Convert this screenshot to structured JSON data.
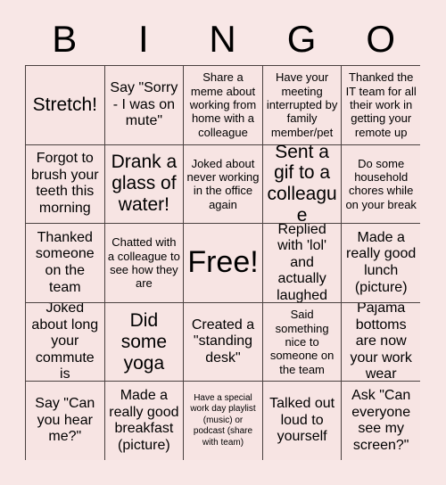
{
  "card": {
    "title": "BINGO",
    "background_color": "#f8e7e6",
    "cell_color": "#f7e4e3",
    "border_color": "#4a4140",
    "text_color": "#000000",
    "header_letters": [
      "B",
      "I",
      "N",
      "G",
      "O"
    ],
    "grid_size": "5x5",
    "free_space": "Free!",
    "rows": [
      [
        {
          "text": "Stretch!",
          "size": "lg"
        },
        {
          "text": "Say \"Sorry - I was on mute\"",
          "size": "md"
        },
        {
          "text": "Share a meme about working from home with a colleague",
          "size": "sm"
        },
        {
          "text": "Have your meeting interrupted by family member/pet",
          "size": "sm"
        },
        {
          "text": "Thanked the IT team for all their work in getting your remote up",
          "size": "sm"
        }
      ],
      [
        {
          "text": "Forgot to brush your teeth this morning",
          "size": "md"
        },
        {
          "text": "Drank a glass of water!",
          "size": "lg"
        },
        {
          "text": "Joked about never working in the office again",
          "size": "sm"
        },
        {
          "text": "Sent a gif to a colleague",
          "size": "lg"
        },
        {
          "text": "Do some household chores while on your break",
          "size": "sm"
        }
      ],
      [
        {
          "text": "Thanked someone on the team",
          "size": "md"
        },
        {
          "text": "Chatted with a colleague to see how they are",
          "size": "sm"
        },
        {
          "text": "Free!",
          "size": "xl"
        },
        {
          "text": "Replied with 'lol' and actually laughed",
          "size": "md"
        },
        {
          "text": "Made a really good lunch (picture)",
          "size": "md"
        }
      ],
      [
        {
          "text": "Joked about long your commute is",
          "size": "md"
        },
        {
          "text": "Did some yoga",
          "size": "lg"
        },
        {
          "text": "Created a \"standing desk\"",
          "size": "md"
        },
        {
          "text": "Said something nice to someone on the team",
          "size": "sm"
        },
        {
          "text": "Pajama bottoms are now your work wear",
          "size": "md"
        }
      ],
      [
        {
          "text": "Say \"Can you hear me?\"",
          "size": "md"
        },
        {
          "text": "Made a really good breakfast (picture)",
          "size": "md"
        },
        {
          "text": "Have a special work day playlist (music) or podcast (share with team)",
          "size": "xxs"
        },
        {
          "text": "Talked out loud to yourself",
          "size": "md"
        },
        {
          "text": "Ask \"Can everyone see my screen?\"",
          "size": "md"
        }
      ]
    ]
  }
}
